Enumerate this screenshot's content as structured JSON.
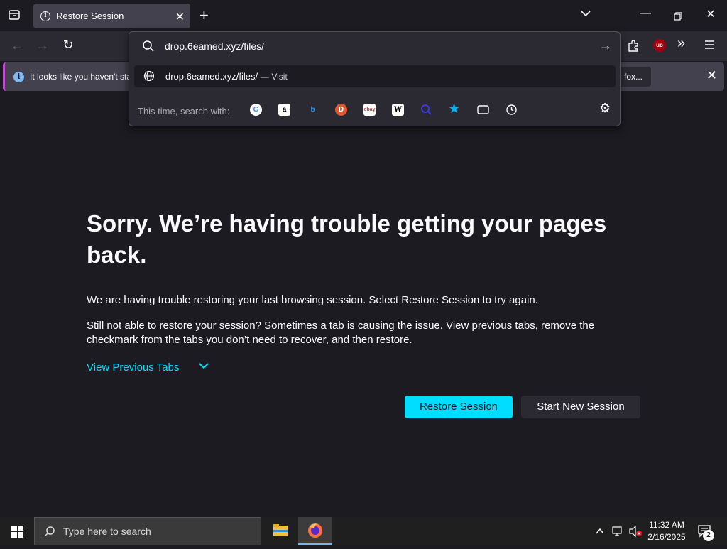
{
  "tabs": [
    {
      "label": "Restore Session",
      "active": true
    }
  ],
  "url_bar": {
    "value": "drop.6eamed.xyz/files/",
    "suggestion": {
      "text": "drop.6eamed.xyz/files/",
      "separator": "—",
      "action": "Visit"
    },
    "search_with_label": "This time, search with:",
    "engines": [
      "google-icon",
      "amazon-icon",
      "bing-icon",
      "duckduckgo-icon",
      "ebay-icon",
      "wikipedia-icon",
      "search-icon",
      "bookmarks-icon",
      "tabs-icon",
      "history-icon"
    ]
  },
  "notification": {
    "text": "It looks like you haven't sta",
    "button_label": "fox..."
  },
  "content": {
    "title": "Sorry. We’re having trouble getting your pages back.",
    "para1": "We are having trouble restoring your last browsing session. Select Restore Session to try again.",
    "para2": "Still not able to restore your session? Sometimes a tab is causing the issue. View previous tabs, remove the checkmark from the tabs you don’t need to recover, and then restore.",
    "view_previous_tabs": "View Previous Tabs",
    "restore_button": "Restore Session",
    "new_session_button": "Start New Session"
  },
  "taskbar": {
    "search_placeholder": "Type here to search",
    "time": "11:32 AM",
    "date": "2/16/2025",
    "notification_count": "2"
  },
  "colors": {
    "accent": "#00ddff",
    "background": "#1c1b22",
    "toolbar": "#2b2a33",
    "notification_border": "#c04cd4"
  }
}
